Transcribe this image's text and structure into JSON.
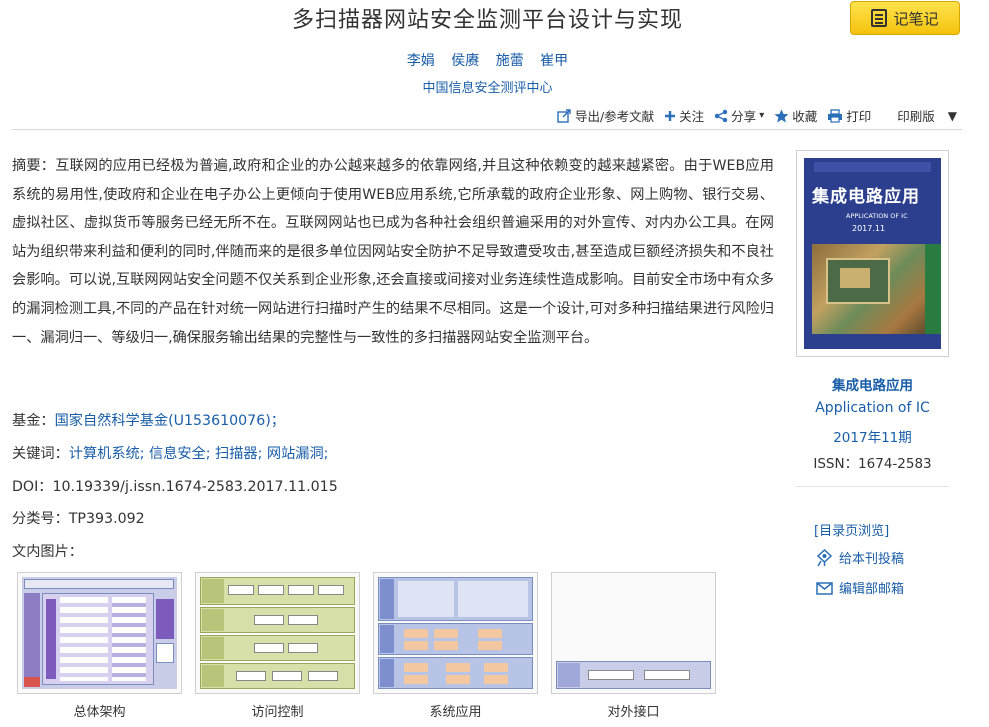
{
  "article": {
    "title": "多扫描器网站安全监测平台设计与实现",
    "authors": [
      "李娟",
      "侯赓",
      "施蕾",
      "崔甲"
    ],
    "organization": "中国信息安全测评中心"
  },
  "note_button": {
    "label": "记笔记",
    "icon": "notebook-icon"
  },
  "toolbar": {
    "export_label": "导出/参考文献",
    "follow_label": "关注",
    "share_label": "分享",
    "favorite_label": "收藏",
    "print_label": "打印",
    "print_version_label": "印刷版"
  },
  "abstract": {
    "label": "摘要：",
    "text": "互联网的应用已经极为普遍,政府和企业的办公越来越多的依靠网络,并且这种依赖变的越来越紧密。由于WEB应用系统的易用性,使政府和企业在电子办公上更倾向于使用WEB应用系统,它所承载的政府企业形象、网上购物、银行交易、虚拟社区、虚拟货币等服务已经无所不在。互联网网站也已成为各种社会组织普遍采用的对外宣传、对内办公工具。在网站为组织带来利益和便利的同时,伴随而来的是很多单位因网站安全防护不足导致遭受攻击,甚至造成巨额经济损失和不良社会影响。可以说,互联网网站安全问题不仅关系到企业形象,还会直接或间接对业务连续性造成影响。目前安全市场中有众多的漏洞检测工具,不同的产品在针对统一网站进行扫描时产生的结果不尽相同。这是一个设计,可对多种扫描结果进行风险归一、漏洞归一、等级归一,确保服务输出结果的完整性与一致性的多扫描器网站安全监测平台。"
  },
  "metadata": {
    "fund_label": "基金：",
    "fund_value": "国家自然科学基金(U153610076)；",
    "keywords_label": "关键词：",
    "keywords": [
      "计算机系统;",
      "信息安全;",
      "扫描器;",
      "网站漏洞;"
    ],
    "doi_label": "DOI：",
    "doi_value": "10.19339/j.issn.1674-2583.2017.11.015",
    "class_label": "分类号：",
    "class_value": "TP393.092",
    "figures_label": "文内图片："
  },
  "figures": [
    {
      "caption": "总体架构"
    },
    {
      "caption": "访问控制"
    },
    {
      "caption": "系统应用"
    },
    {
      "caption": "对外接口"
    }
  ],
  "journal": {
    "cover_title": "集成电路应用",
    "cover_subtitle": "APPLICATION OF IC",
    "cover_issue": "2017.11",
    "name_cn": "集成电路应用",
    "name_en": "Application of IC",
    "issue": "2017年11期",
    "issn": "ISSN：1674-2583"
  },
  "side_links": {
    "toc": "[目录页浏览]",
    "submit": "给本刊投稿",
    "email": "编辑部邮箱"
  },
  "colors": {
    "link": "#1a5ea8",
    "note_button": "#f4c20d",
    "cover": "#2c3f8f"
  }
}
